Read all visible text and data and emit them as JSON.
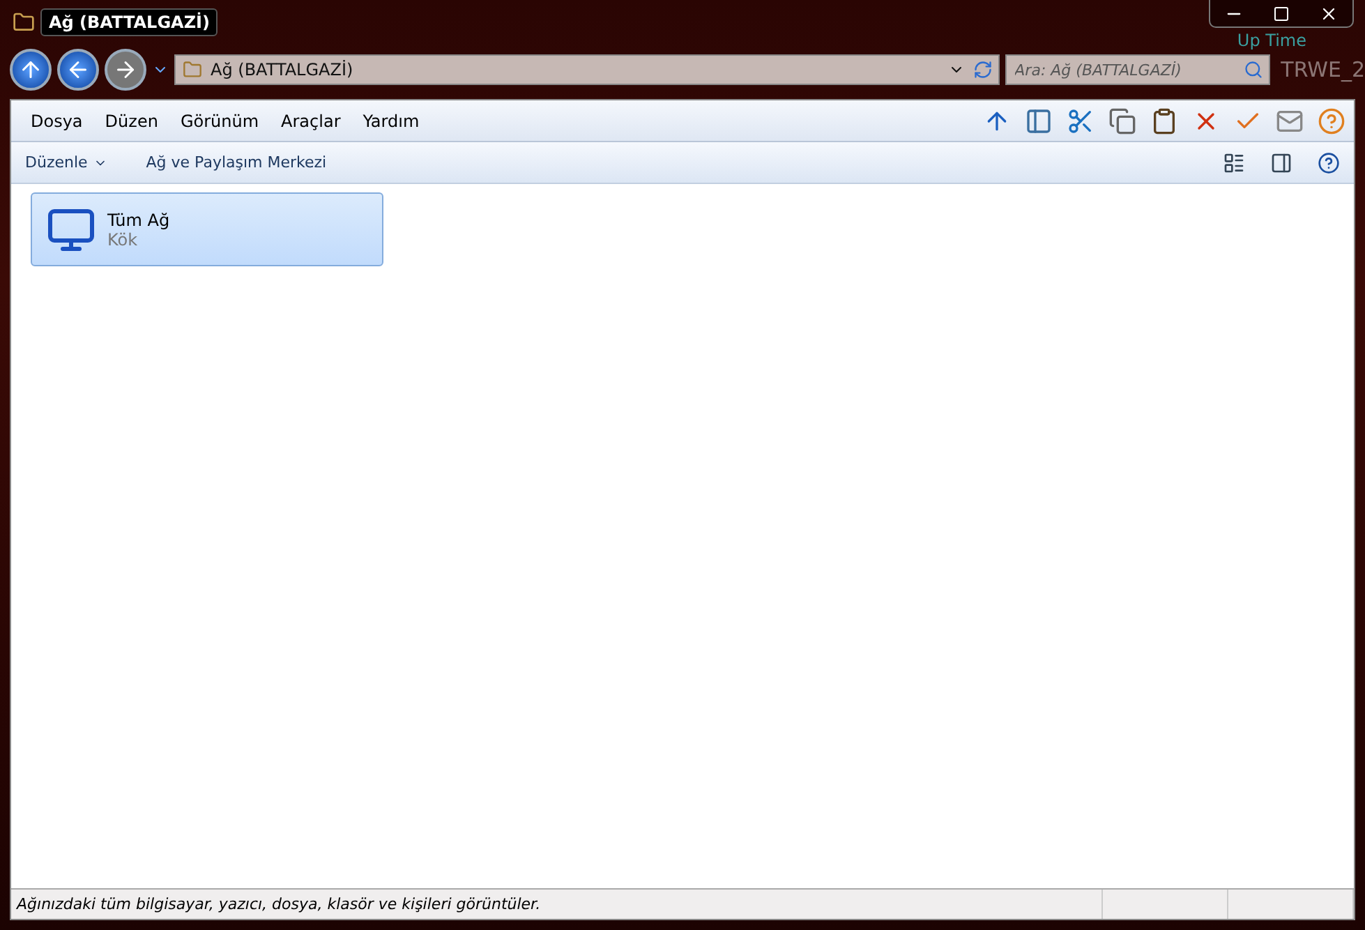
{
  "window": {
    "title": "Ağ (BATTALGAZİ)"
  },
  "desktop_overlay": [
    "Up Time",
    "TRWE_2"
  ],
  "address_bar": {
    "path": "Ağ (BATTALGAZİ)"
  },
  "search": {
    "placeholder": "Ara: Ağ (BATTALGAZİ)"
  },
  "menu": [
    "Dosya",
    "Düzen",
    "Görünüm",
    "Araçlar",
    "Yardım"
  ],
  "command_bar": [
    {
      "kind": "dropdown",
      "label": "Düzenle"
    },
    {
      "kind": "link",
      "label": "Ağ ve Paylaşım Merkezi"
    }
  ],
  "items": [
    {
      "name": "Tüm Ağ",
      "subtitle": "Kök",
      "selected": true
    }
  ],
  "status_bar": {
    "text": "Ağınızdaki tüm bilgisayar, yazıcı, dosya, klasör ve kişileri görüntüler."
  }
}
